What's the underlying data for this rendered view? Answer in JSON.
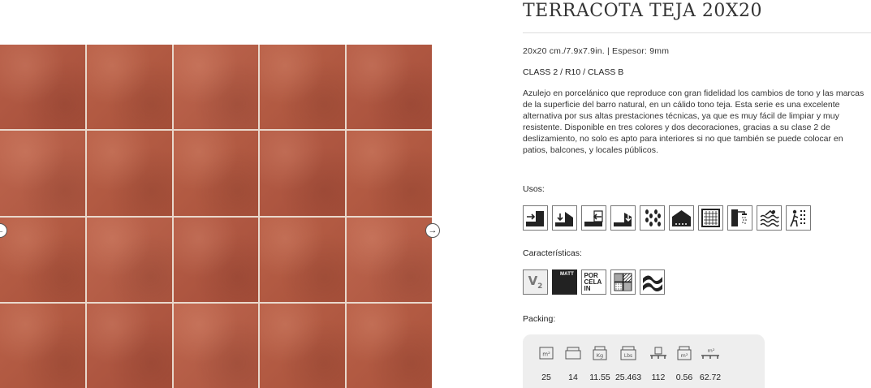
{
  "product": {
    "title": "TERRACOTA TEJA 20X20",
    "dimensions": "20x20 cm./7.9x7.9in.  |  Espesor: 9mm",
    "class_line": "CLASS 2 / R10 / CLASS B",
    "description": "Azulejo en porcelánico que reproduce con gran fidelidad los cambios de tono y las marcas de la superficie del barro natural, en un cálido tono teja. Esta serie es una excelente alternativa por sus altas prestaciones técnicas, ya que es muy fácil de limpiar y muy resistente. Disponible en tres colores y dos decoraciones, gracias a su clase 2 de deslizamiento, no solo es apto para interiores si no que también se puede colocar en patios, balcones, y locales públicos."
  },
  "gallery": {
    "prev_glyph": "←",
    "next_glyph": "→",
    "tile_color": "#b25a42"
  },
  "usos": {
    "label": "Usos:",
    "icons": [
      "wall-arrow-in-icon",
      "floor-arrow-down-icon",
      "wall-arrow-out-icon",
      "floor-arrow-down-outdoor-icon",
      "footprints-icon",
      "house-floor-icon",
      "tile-grid-icon",
      "shower-icon",
      "pool-waves-icon",
      "bathroom-person-icon"
    ]
  },
  "caracteristicas": {
    "label": "Características:",
    "slip_label": "V",
    "slip_sub": "2",
    "matt_label": "MATT",
    "porcelain_lines": [
      "POR",
      "CELA",
      "IN"
    ],
    "icons": [
      "variation-v2-icon",
      "matt-finish-icon",
      "porcelain-icon",
      "rectified-pattern-icon",
      "wavy-surface-icon"
    ]
  },
  "packing": {
    "label": "Packing:",
    "items": [
      {
        "icon": "sqm-icon",
        "icon_text": "m²",
        "value": "25"
      },
      {
        "icon": "box-icon",
        "icon_text": "",
        "value": "14"
      },
      {
        "icon": "box-kg-icon",
        "icon_text": "Kg",
        "value": "11.55"
      },
      {
        "icon": "box-lbs-icon",
        "icon_text": "Lbs",
        "value": "25.463"
      },
      {
        "icon": "pallet-boxes-icon",
        "icon_text": "",
        "value": "112"
      },
      {
        "icon": "box-sqm-icon",
        "icon_text": "m²",
        "value": "0.56"
      },
      {
        "icon": "pallet-sqm-icon",
        "icon_text": "m²",
        "value": "62.72"
      }
    ]
  }
}
